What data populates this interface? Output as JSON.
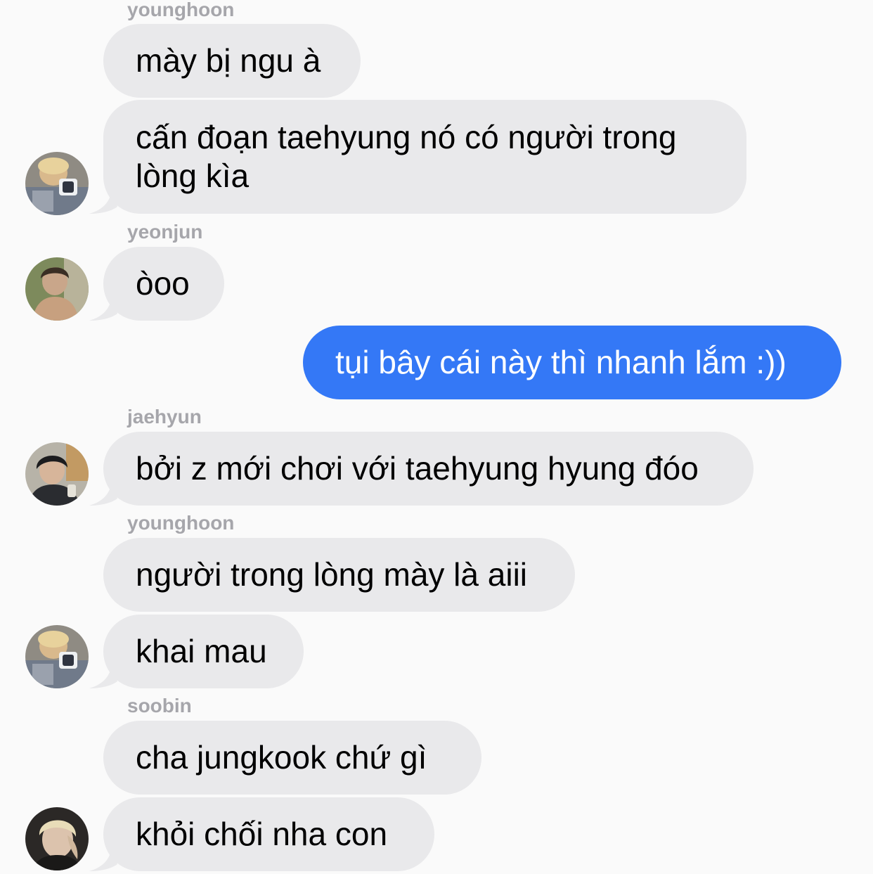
{
  "conversation": {
    "messages": [
      {
        "sender": "younghoon",
        "text": "mày bị ngu à"
      },
      {
        "text_line1": "cấn đoạn taehyung nó có người trong",
        "text_line2": "lòng kìa"
      },
      {
        "sender": "yeonjun",
        "text": "òoo"
      },
      {
        "text": "tụi bây cái này thì nhanh lắm :))"
      },
      {
        "sender": "jaehyun",
        "text": "bởi z mới chơi với taehyung hyung đóo"
      },
      {
        "sender": "younghoon",
        "text": "người trong lòng mày là aiii"
      },
      {
        "text": "khai mau"
      },
      {
        "sender": "soobin",
        "text": "cha jungkook chứ gì"
      },
      {
        "text": "khỏi chối nha con"
      }
    ]
  },
  "colors": {
    "background": "#fafafa",
    "incoming_bubble": "#e9e9eb",
    "outgoing_bubble": "#3478f6",
    "sender_label": "#a6a6ab"
  },
  "icons": {
    "avatars": [
      "younghoon-avatar-icon",
      "yeonjun-avatar-icon",
      "jaehyun-avatar-icon",
      "younghoon-avatar-icon",
      "soobin-avatar-icon"
    ]
  }
}
